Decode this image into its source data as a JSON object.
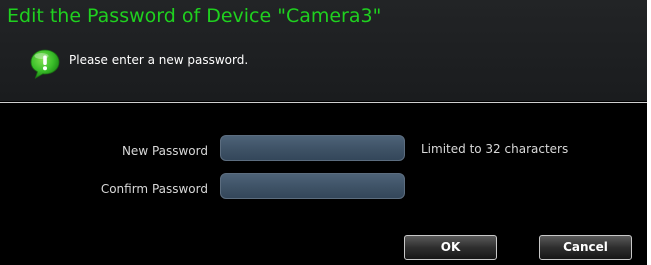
{
  "dialog": {
    "title": "Edit the Password of Device \"Camera3\"",
    "info_text": "Please enter a new password.",
    "info_icon": "info-bubble-icon"
  },
  "form": {
    "new_password": {
      "label": "New Password",
      "value": "",
      "hint": "Limited to 32 characters"
    },
    "confirm_password": {
      "label": "Confirm Password",
      "value": ""
    }
  },
  "buttons": {
    "ok_label": "OK",
    "cancel_label": "Cancel"
  },
  "colors": {
    "title": "#1fd11f",
    "icon": "#3bbf2a",
    "background": "#000000",
    "header": "#1e2022",
    "input": "#445a70"
  }
}
